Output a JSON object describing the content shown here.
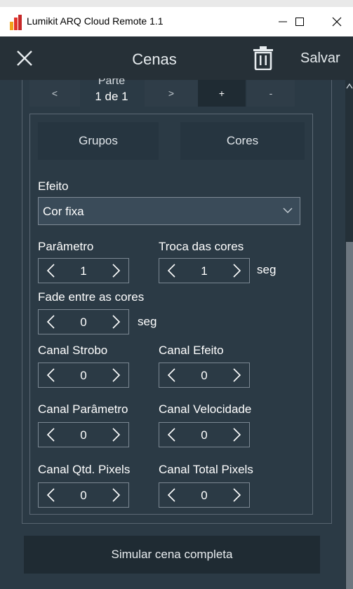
{
  "window": {
    "title": "Lumikit ARQ Cloud Remote 1.1",
    "minimize_glyph": "—",
    "maximize_glyph": "☐",
    "close_glyph": "✕"
  },
  "header": {
    "title": "Cenas",
    "save_label": "Salvar"
  },
  "parts": {
    "label": "Parte",
    "value": "1 de 1",
    "prev": "<",
    "next": ">",
    "add": "+",
    "remove": "-"
  },
  "tabs": {
    "groups": "Grupos",
    "colors": "Cores"
  },
  "effect": {
    "label": "Efeito",
    "value": "Cor fixa"
  },
  "fields": {
    "parameter": {
      "label": "Parâmetro",
      "value": "1"
    },
    "color_change": {
      "label": "Troca das cores",
      "value": "1",
      "unit": "seg"
    },
    "fade": {
      "label": "Fade entre as cores",
      "value": "0",
      "unit": "seg"
    },
    "strobe_channel": {
      "label": "Canal Strobo",
      "value": "0"
    },
    "effect_channel": {
      "label": "Canal Efeito",
      "value": "0"
    },
    "parameter_channel": {
      "label": "Canal Parâmetro",
      "value": "0"
    },
    "speed_channel": {
      "label": "Canal Velocidade",
      "value": "0"
    },
    "pixel_qty_channel": {
      "label": "Canal Qtd. Pixels",
      "value": "0"
    },
    "total_pixels_channel": {
      "label": "Canal Total Pixels",
      "value": "0"
    }
  },
  "simulate_label": "Simular cena completa",
  "icons": {
    "app": "lumikit-app-icon",
    "close": "close-icon",
    "delete": "trash-icon",
    "chevron": "chevron-down-icon",
    "decrement": "chevron-left-icon",
    "increment": "chevron-right-icon"
  },
  "colors": {
    "background": "#2b3a45",
    "header": "#263037",
    "button": "#263540",
    "accent_border": "#7b8792"
  }
}
